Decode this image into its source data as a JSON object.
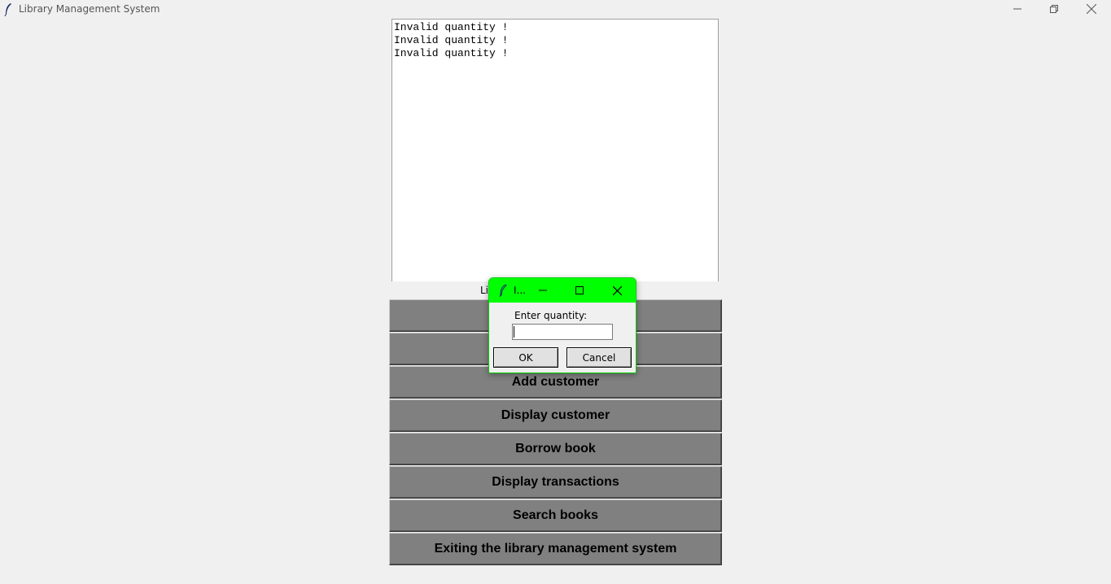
{
  "window": {
    "title": "Library Management System",
    "icon": "feather-icon"
  },
  "output": {
    "lines": [
      "Invalid quantity !",
      "Invalid quantity !",
      "Invalid quantity !"
    ]
  },
  "label_partial": "Li",
  "menu_buttons": [
    {
      "label": ""
    },
    {
      "label": ""
    },
    {
      "label": "Add customer"
    },
    {
      "label": "Display customer"
    },
    {
      "label": "Borrow book"
    },
    {
      "label": "Display transactions"
    },
    {
      "label": "Search books"
    },
    {
      "label": "Exiting the library management system"
    }
  ],
  "dialog": {
    "title": "I...",
    "titlebar_color": "#00ff00",
    "prompt": "Enter quantity:",
    "input_value": "",
    "ok_label": "OK",
    "cancel_label": "Cancel"
  }
}
